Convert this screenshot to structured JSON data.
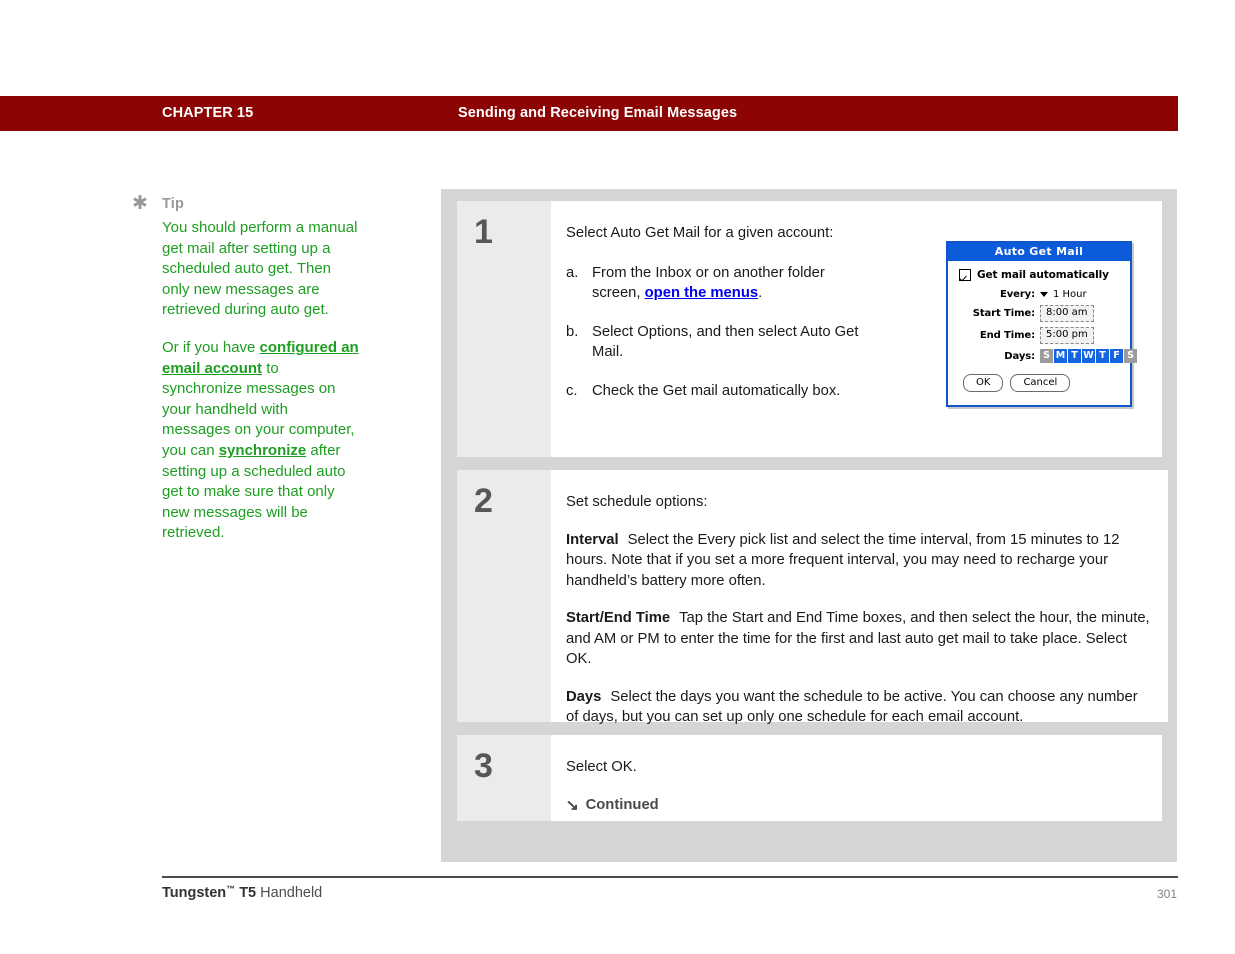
{
  "header": {
    "chapter": "CHAPTER 15",
    "title": "Sending and Receiving Email Messages",
    "bar_color": "#8C0404"
  },
  "tip": {
    "icon": "asterisk-icon",
    "label": "Tip",
    "text_color": "#1E9E22",
    "paragraph1_pre": "You should perform a manual get mail after setting up a scheduled auto get. Then only new messages are retrieved during auto get.",
    "paragraph2_pre": "Or if you have ",
    "paragraph2_link": "configured an email account",
    "paragraph2_mid": " to synchronize messages on your handheld with messages on your computer, you can ",
    "paragraph2_link2": "synchronize",
    "paragraph2_post": " after setting up a scheduled auto get to make sure that only new messages will be retrieved."
  },
  "steps": [
    {
      "number": "1",
      "intro": "Select Auto Get Mail for a given account:",
      "items": [
        {
          "marker": "a.",
          "pre": "From the Inbox or on another folder screen, ",
          "link": "open the menus",
          "post": "."
        },
        {
          "marker": "b.",
          "pre": "Select Options, and then select Auto Get Mail.",
          "link": "",
          "post": ""
        },
        {
          "marker": "c.",
          "pre": "Check the Get mail automatically box.",
          "link": "",
          "post": ""
        }
      ]
    },
    {
      "number": "2",
      "intro": "Set schedule options:",
      "paragraphs": [
        {
          "term": "Interval",
          "body": "Select the Every pick list and select the time interval, from 15 minutes to 12 hours. Note that if you set a more frequent interval, you may need to recharge your handheld’s battery more often."
        },
        {
          "term": "Start/End Time",
          "body": "Tap the Start and End Time boxes, and then select the hour, the minute, and AM or PM to enter the time for the first and last auto get mail to take place. Select OK."
        },
        {
          "term": "Days",
          "body": "Select the days you want the schedule to be active. You can choose any number of days, but you can set up only one schedule for each email account."
        }
      ]
    },
    {
      "number": "3",
      "intro": "Select OK.",
      "continued_icon": "arrow-down-right-icon",
      "continued_label": "Continued"
    }
  ],
  "pda_dialog": {
    "title": "Auto Get Mail",
    "title_bg": "#0C5BDB",
    "border_color": "#1156C9",
    "checkbox_icon": "checkbox-checked-icon",
    "checkbox_label": "Get mail automatically",
    "every_label": "Every:",
    "every_picker_icon": "triangle-down-icon",
    "every_value": "1 Hour",
    "start_label": "Start Time:",
    "start_value": "8:00 am",
    "end_label": "End Time:",
    "end_value": "5:00 pm",
    "days_label": "Days:",
    "days": [
      {
        "letter": "S",
        "selected": false
      },
      {
        "letter": "M",
        "selected": true
      },
      {
        "letter": "T",
        "selected": true
      },
      {
        "letter": "W",
        "selected": true
      },
      {
        "letter": "T",
        "selected": true
      },
      {
        "letter": "F",
        "selected": true
      },
      {
        "letter": "S",
        "selected": false
      }
    ],
    "day_on_color": "#1565E0",
    "day_off_color": "#9C9C9C",
    "ok_label": "OK",
    "cancel_label": "Cancel"
  },
  "footer": {
    "brand": "Tungsten",
    "tm": "™",
    "model": " T5",
    "product": " Handheld",
    "page": "301"
  }
}
